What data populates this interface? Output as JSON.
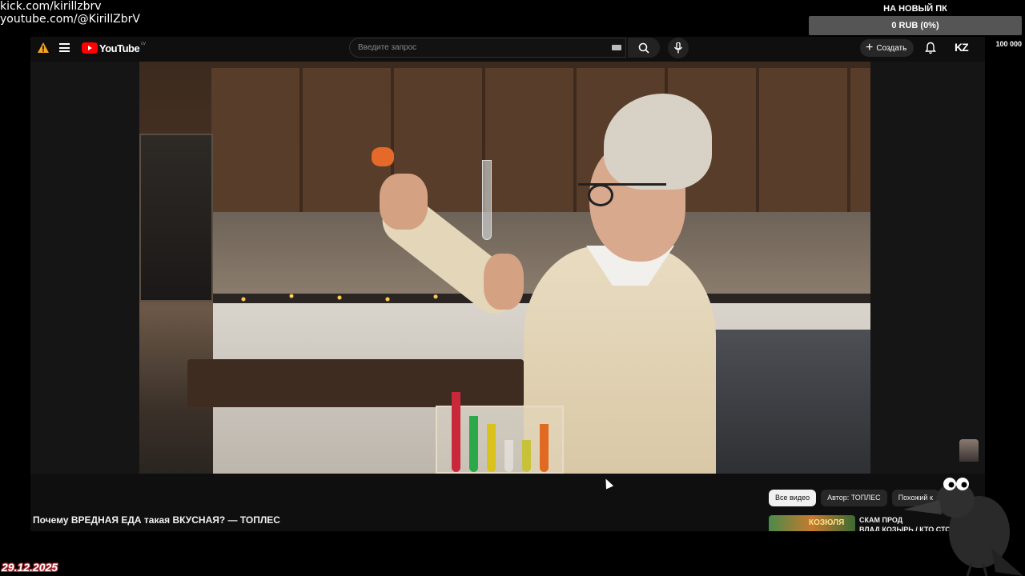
{
  "stream_overlay": {
    "links": [
      "kick.com/kirillzbrv",
      "youtube.com/@KirillZbrV"
    ],
    "donation_goal": {
      "title": "НА НОВЫЙ ПК",
      "progress_text": "0 RUB (0%)",
      "progress": 0,
      "min": "0",
      "max": "100 000"
    },
    "date": "29.12.2025"
  },
  "youtube": {
    "logo_text": "YouTube",
    "logo_region": "LV",
    "search": {
      "placeholder": "Введите запрос",
      "value": ""
    },
    "create_label": "Создать",
    "account_badge": "KZ",
    "video_title": "Почему ВРЕДНАЯ ЕДА такая ВКУСНАЯ? — ТОПЛЕС",
    "chips": [
      "Все видео",
      "Автор: ТОПЛЕС",
      "Похожий к"
    ],
    "active_chip": 0,
    "recommendation": {
      "thumb_text": "КОЗЮЛЯ",
      "title_line1": "СКАМ ПРОД",
      "title_line2": "ВЛАД КОЗЫРЬ / КТО СТОИ"
    }
  },
  "colors": {
    "accent": "#ff0000",
    "background": "#0f0f0f",
    "chip_active": "#f1f1f1",
    "date_outline": "#b4242d"
  },
  "icons": [
    "warning-icon",
    "menu-icon",
    "keyboard-icon",
    "search-icon",
    "mic-icon",
    "plus-icon",
    "bell-icon"
  ]
}
